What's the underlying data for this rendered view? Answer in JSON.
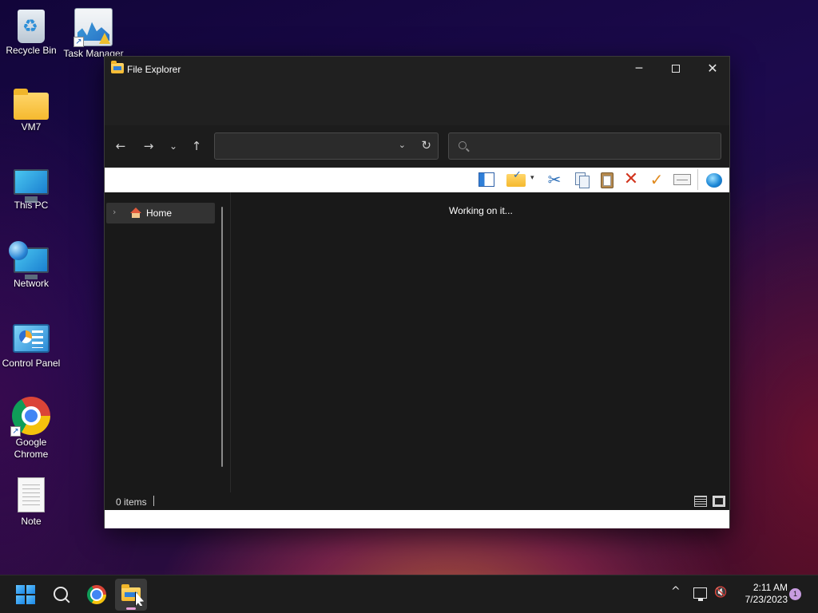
{
  "desktop": {
    "icons": [
      {
        "label": "Recycle Bin",
        "icon": "recycle-bin-icon"
      },
      {
        "label": "Task Manager",
        "icon": "task-manager-icon"
      },
      {
        "label": "VM7",
        "icon": "folder-icon"
      },
      {
        "label": "This PC",
        "icon": "computer-icon"
      },
      {
        "label": "Network",
        "icon": "network-icon"
      },
      {
        "label": "Control Panel",
        "icon": "control-panel-icon"
      },
      {
        "label": "Google Chrome",
        "icon": "chrome-icon"
      },
      {
        "label": "Note",
        "icon": "text-file-icon"
      }
    ]
  },
  "window": {
    "title": "File Explorer",
    "controls": {
      "minimize": "─",
      "close": "✕"
    },
    "nav": {
      "back": "←",
      "forward": "→",
      "recent": "⌄",
      "up": "↑"
    },
    "address": {
      "value": "",
      "dropdown": "⌄",
      "refresh": "↻"
    },
    "search": {
      "placeholder": ""
    },
    "toolbar": {
      "cut": "✂",
      "delete": "✕",
      "check": "✓",
      "dropdown": "▾"
    },
    "nav_pane": {
      "items": [
        {
          "label": "Home",
          "expander": "›"
        }
      ]
    },
    "main": {
      "status_text": "Working on it..."
    },
    "status_bar": {
      "item_count": "0 items"
    }
  },
  "taskbar": {
    "apps": [
      "start",
      "search",
      "google-chrome",
      "file-explorer"
    ],
    "tray": {
      "chevron": "^",
      "volume": "🔇",
      "time": "2:11 AM",
      "date": "7/23/2023",
      "notification_count": "1"
    }
  },
  "colors": {
    "window_bg": "#202020",
    "content_bg": "#191919",
    "taskbar_bg": "#1c1c1c",
    "accent": "#1a87e6",
    "notification_badge": "#c89ce0"
  }
}
